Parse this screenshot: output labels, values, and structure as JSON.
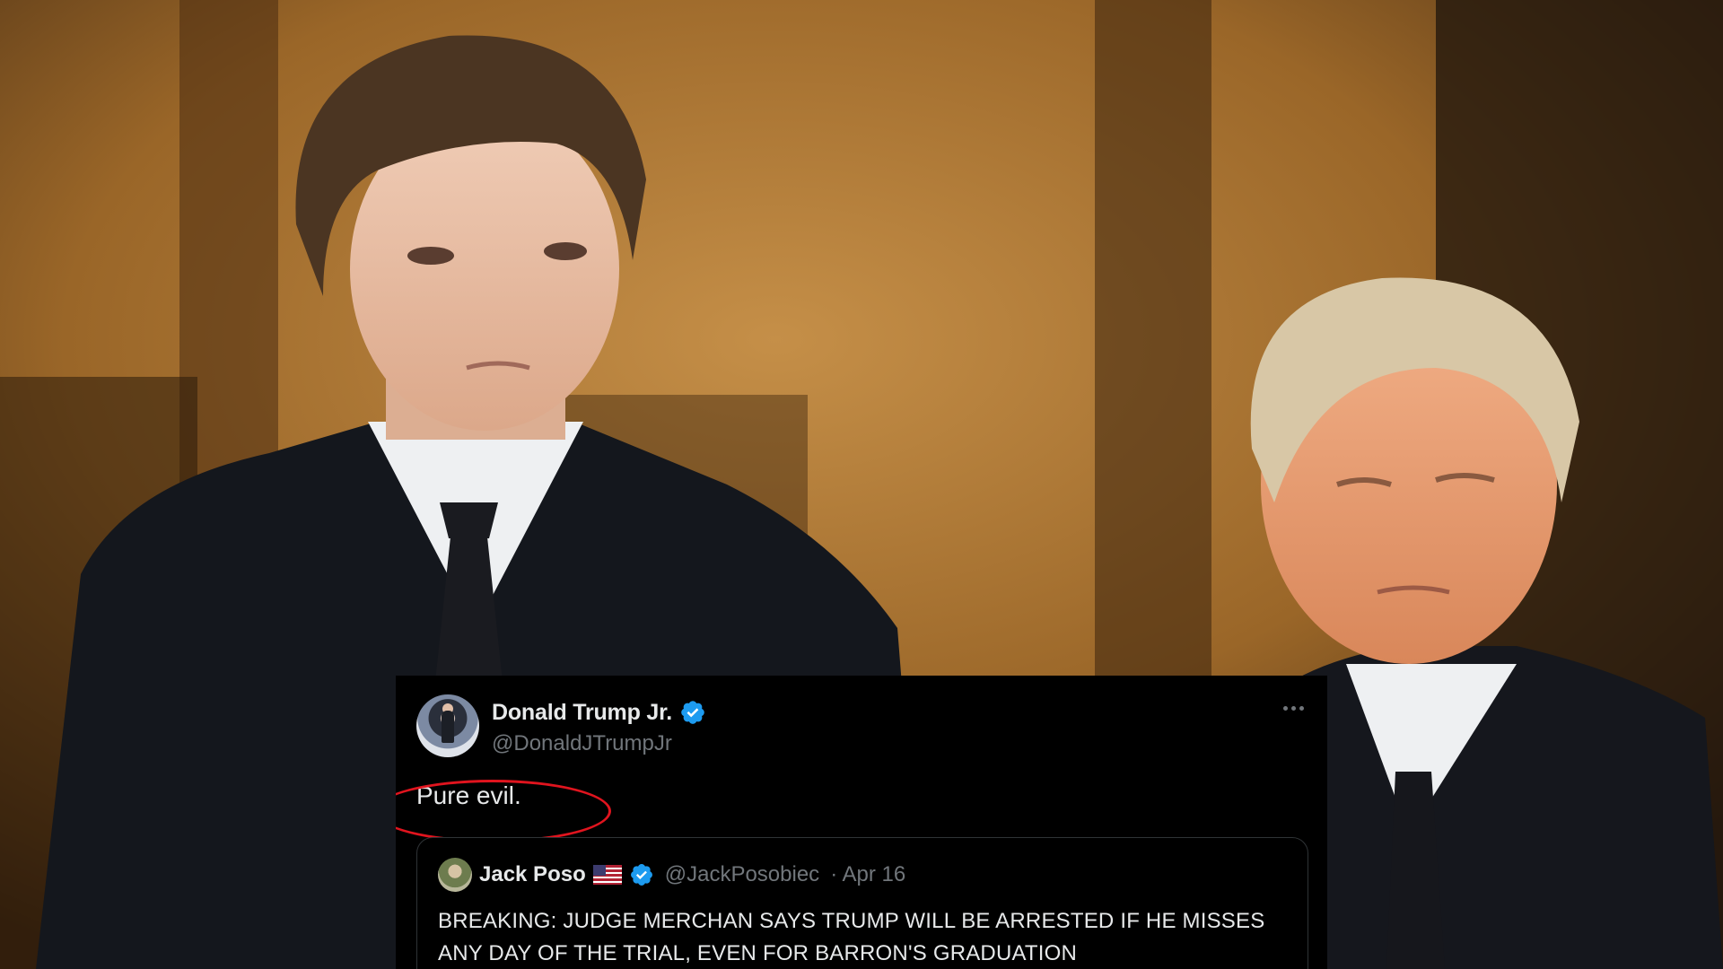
{
  "tweet": {
    "author_name": "Donald Trump Jr.",
    "author_handle": "@DonaldJTrumpJr",
    "text": "Pure evil.",
    "quoted": {
      "author_name": "Jack Poso",
      "author_handle": "@JackPosobiec",
      "date": "· Apr 16",
      "text": "BREAKING: JUDGE MERCHAN SAYS TRUMP WILL BE ARRESTED IF HE MISSES ANY DAY OF THE TRIAL, EVEN FOR BARRON'S GRADUATION"
    }
  },
  "icons": {
    "verified": "verified-badge-icon",
    "more": "more-horizontal-icon",
    "flag": "us-flag-icon"
  },
  "colors": {
    "background_tone": "#b07a38",
    "tweet_bg": "#000000",
    "verified_blue": "#1d9bf0",
    "highlight_circle": "#e0141e"
  }
}
